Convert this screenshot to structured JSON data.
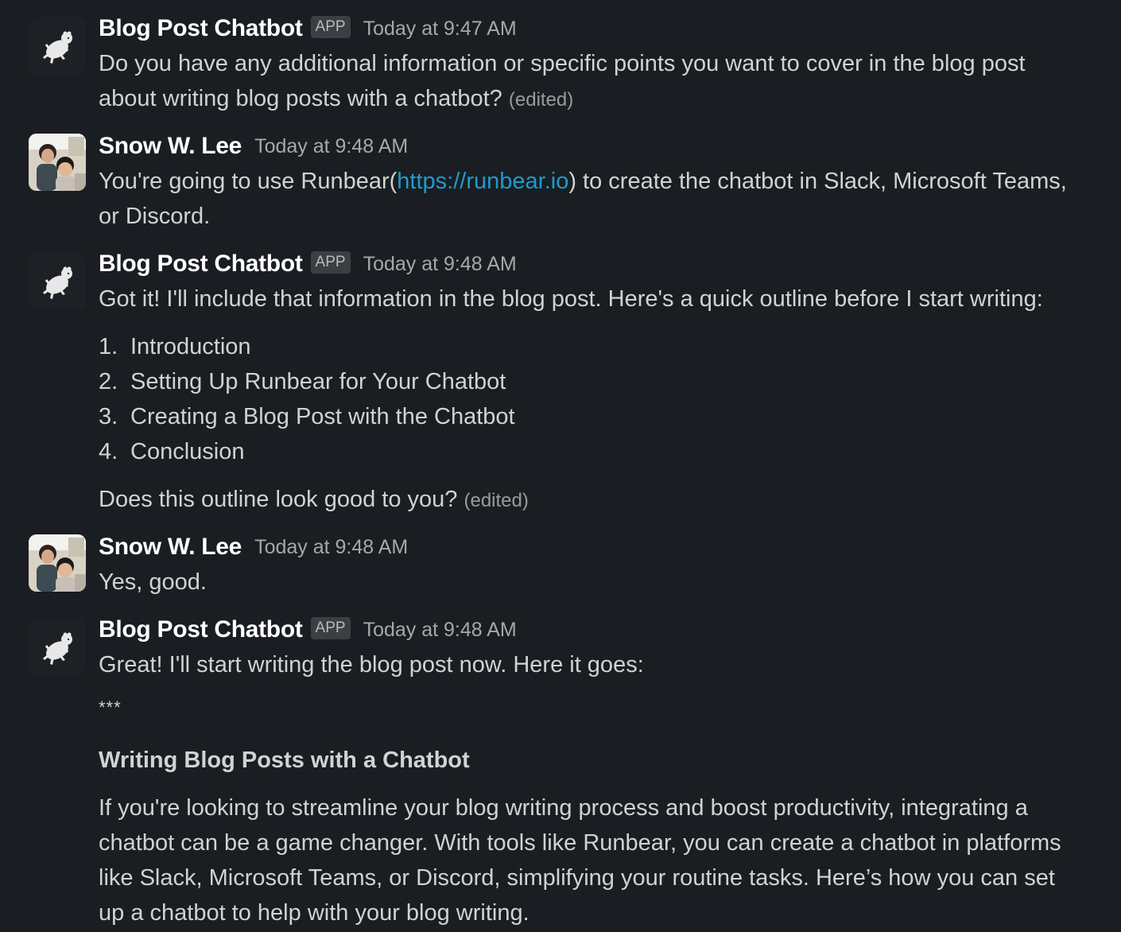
{
  "messages": [
    {
      "sender": "Blog Post Chatbot",
      "badge": "APP",
      "time": "Today at 9:47 AM",
      "lines": [
        "Do you have any additional information or specific points you want to cover in the blog post",
        "about writing blog posts with a chatbot?"
      ],
      "edited": "(edited)"
    },
    {
      "sender": "Snow W. Lee",
      "time": "Today at 9:48 AM",
      "line1_pre": "You're going to use Runbear(",
      "link": "https://runbear.io",
      "line1_post": ") to create the chatbot in Slack, Microsoft Teams,",
      "line2": "or Discord."
    },
    {
      "sender": "Blog Post Chatbot",
      "badge": "APP",
      "time": "Today at 9:48 AM",
      "intro": "Got it! I'll include that information in the blog post. Here's a quick outline before I start writing:",
      "list": [
        {
          "num": "1.",
          "text": "Introduction"
        },
        {
          "num": "2.",
          "text": "Setting Up Runbear for Your Chatbot"
        },
        {
          "num": "3.",
          "text": "Creating a Blog Post with the Chatbot"
        },
        {
          "num": "4.",
          "text": "Conclusion"
        }
      ],
      "closing": "Does this outline look good to you?",
      "edited": "(edited)"
    },
    {
      "sender": "Snow W. Lee",
      "time": "Today at 9:48 AM",
      "text": "Yes, good."
    },
    {
      "sender": "Blog Post Chatbot",
      "badge": "APP",
      "time": "Today at 9:48 AM",
      "intro": "Great! I'll start writing the blog post now. Here it goes:",
      "divider": "***",
      "heading": "Writing Blog Posts with a Chatbot",
      "paragraph": [
        "If you're looking to streamline your blog writing process and boost productivity, integrating a",
        "chatbot can be a game changer. With tools like Runbear, you can create a chatbot in platforms",
        "like Slack, Microsoft Teams, or Discord, simplifying your routine tasks. Here’s how you can set",
        "up a chatbot to help with your blog writing."
      ]
    }
  ],
  "icons": {
    "bot_avatar": "running-polar-bear-icon",
    "user_avatar": "user-photo-avatar"
  }
}
